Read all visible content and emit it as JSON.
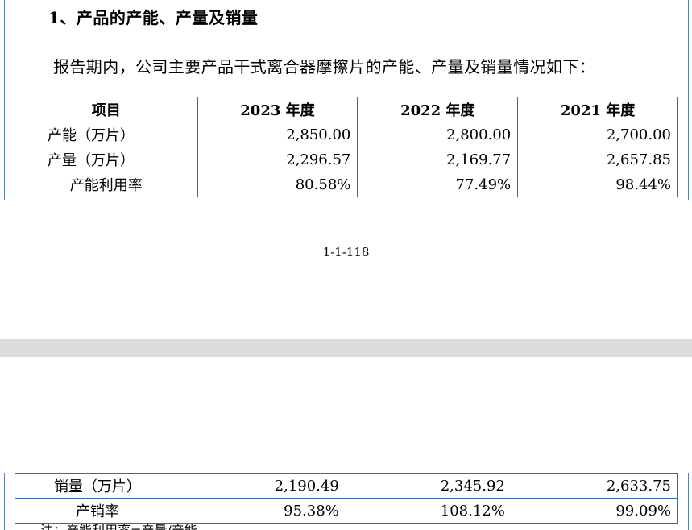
{
  "section_heading": "1、产品的产能、产量及销量",
  "intro_paragraph": "报告期内，公司主要产品干式离合器摩擦片的产能、产量及销量情况如下：",
  "table_top": {
    "headers": [
      "项目",
      "2023 年度",
      "2022 年度",
      "2021 年度"
    ],
    "rows": [
      [
        "产能（万片）",
        "2,850.00",
        "2,800.00",
        "2,700.00"
      ],
      [
        "产量（万片）",
        "2,296.57",
        "2,169.77",
        "2,657.85"
      ],
      [
        "产能利用率",
        "80.58%",
        "77.49%",
        "98.44%"
      ]
    ]
  },
  "page_number": "1-1-118",
  "table_bottom": {
    "rows": [
      [
        "销量（万片）",
        "2,190.49",
        "2,345.92",
        "2,633.75"
      ],
      [
        "产销率",
        "95.38%",
        "108.12%",
        "99.09%"
      ]
    ]
  },
  "cut_off_note": "注：产能利用率=产量/产能"
}
